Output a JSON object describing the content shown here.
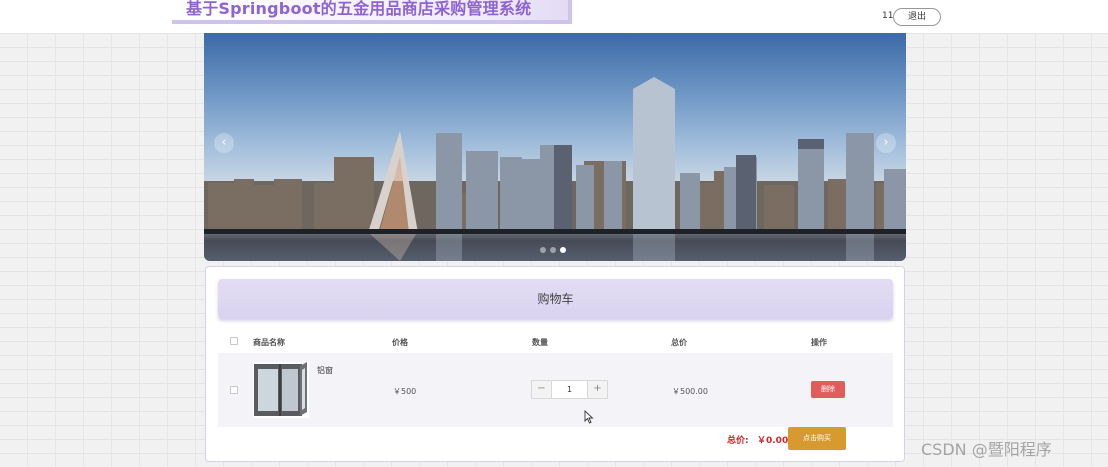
{
  "header": {
    "site_title": "基于Springboot的五金用品商店采购管理系统",
    "username": "11",
    "logout_label": "退出"
  },
  "carousel": {
    "prev_icon": "chevron-left-icon",
    "next_icon": "chevron-right-icon",
    "prev_glyph": "‹",
    "next_glyph": "›",
    "slide_count": 3,
    "active_slide": 3
  },
  "cart": {
    "title": "购物车",
    "columns": [
      "商品名称",
      "价格",
      "数量",
      "总价",
      "操作"
    ],
    "items": [
      {
        "checked": false,
        "name": "铝窗",
        "price": "￥500",
        "quantity": "1",
        "minus_glyph": "−",
        "plus_glyph": "+",
        "subtotal": "￥500.00",
        "action_label": "删除"
      }
    ],
    "total_label": "总价:",
    "total_value": "￥0.00",
    "buy_label": "点击购买"
  },
  "colors": {
    "title_text": "#8e63d6",
    "delete_button": "#e25c5c",
    "buy_button": "#d69a2e",
    "total_text": "#d9252a"
  },
  "watermark": "CSDN @暨阳程序"
}
